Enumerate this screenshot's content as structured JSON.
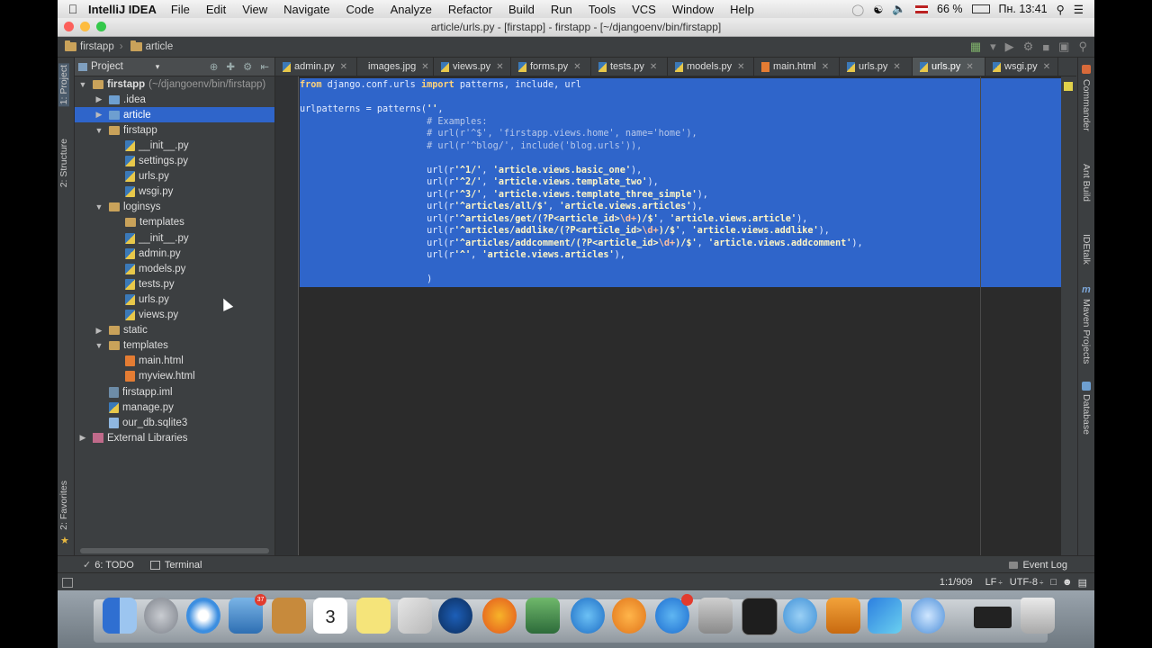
{
  "menubar": {
    "app_name": "IntelliJ IDEA",
    "items": [
      "File",
      "Edit",
      "View",
      "Navigate",
      "Code",
      "Analyze",
      "Refactor",
      "Build",
      "Run",
      "Tools",
      "VCS",
      "Window",
      "Help"
    ],
    "battery": "66 %",
    "clock": "Пн. 13:41"
  },
  "window": {
    "title": "article/urls.py - [firstapp] - firstapp - [~/djangoenv/bin/firstapp]"
  },
  "navbar": {
    "crumb1": "firstapp",
    "crumb2": "article"
  },
  "left_tabs": {
    "project": "1: Project",
    "structure": "2: Structure",
    "favorites": "2: Favorites"
  },
  "project_panel": {
    "header": "Project",
    "tree": [
      {
        "label": "firstapp",
        "sub": "(~/djangoenv/bin/firstapp)",
        "type": "dir",
        "bold": true
      },
      {
        "label": ".idea",
        "type": "dir"
      },
      {
        "label": "article",
        "type": "dir",
        "selected": true
      },
      {
        "label": "firstapp",
        "type": "dir"
      },
      {
        "label": "__init__.py",
        "type": "py"
      },
      {
        "label": "settings.py",
        "type": "py"
      },
      {
        "label": "urls.py",
        "type": "py"
      },
      {
        "label": "wsgi.py",
        "type": "py"
      },
      {
        "label": "loginsys",
        "type": "dir"
      },
      {
        "label": "templates",
        "type": "dir"
      },
      {
        "label": "__init__.py",
        "type": "py"
      },
      {
        "label": "admin.py",
        "type": "py"
      },
      {
        "label": "models.py",
        "type": "py"
      },
      {
        "label": "tests.py",
        "type": "py"
      },
      {
        "label": "urls.py",
        "type": "py"
      },
      {
        "label": "views.py",
        "type": "py"
      },
      {
        "label": "static",
        "type": "dir"
      },
      {
        "label": "templates",
        "type": "dir"
      },
      {
        "label": "main.html",
        "type": "html"
      },
      {
        "label": "myview.html",
        "type": "html"
      },
      {
        "label": "firstapp.iml",
        "type": "iml"
      },
      {
        "label": "manage.py",
        "type": "py"
      },
      {
        "label": "our_db.sqlite3",
        "type": "db"
      },
      {
        "label": "External Libraries",
        "type": "lib"
      }
    ]
  },
  "editor_tabs": [
    "admin.py",
    "images.jpg",
    "views.py",
    "forms.py",
    "tests.py",
    "models.py",
    "main.html",
    "urls.py",
    "urls.py",
    "wsgi.py"
  ],
  "active_tab_index": 8,
  "code_lines": [
    "from django.conf.urls import patterns, include, url",
    "",
    "urlpatterns = patterns('',",
    "                       # Examples:",
    "                       # url(r'^$', 'firstapp.views.home', name='home'),",
    "                       # url(r'^blog/', include('blog.urls')),",
    "",
    "                       url(r'^1/', 'article.views.basic_one'),",
    "                       url(r'^2/', 'article.views.template_two'),",
    "                       url(r'^3/', 'article.views.template_three_simple'),",
    "                       url(r'^articles/all/$', 'article.views.articles'),",
    "                       url(r'^articles/get/(?P<article_id>\\d+)/$', 'article.views.article'),",
    "                       url(r'^articles/addlike/(?P<article_id>\\d+)/$', 'article.views.addlike'),",
    "                       url(r'^articles/addcomment/(?P<article_id>\\d+)/$', 'article.views.addcomment'),",
    "                       url(r'^', 'article.views.articles'),",
    "",
    "                       )"
  ],
  "right_tabs": [
    "Commander",
    "Ant Build",
    "IDEtalk",
    "Maven Projects",
    "Database"
  ],
  "bottom_toolbar": {
    "todo": "6: TODO",
    "terminal": "Terminal",
    "event_log": "Event Log"
  },
  "statusbar": {
    "position": "1:1/909",
    "line_sep": "LF",
    "encoding": "UTF-8"
  },
  "dock": {
    "mail_badge": "37",
    "calendar_day": "3"
  },
  "colors": {
    "selection": "#2f65ca",
    "editor_bg": "#2b2b2b",
    "panel_bg": "#3c3f41"
  }
}
